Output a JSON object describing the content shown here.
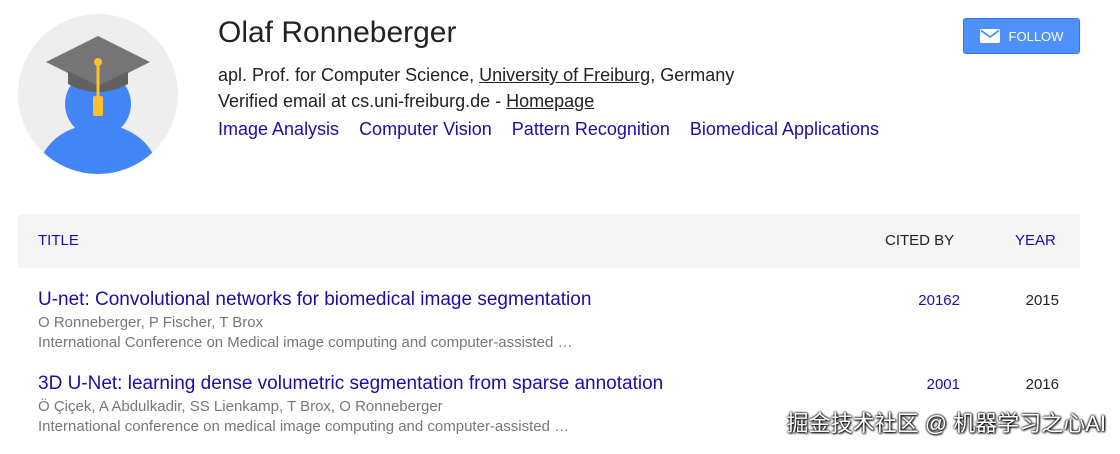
{
  "profile": {
    "name": "Olaf Ronneberger",
    "affiliation_prefix": "apl. Prof. for Computer Science, ",
    "affiliation_link": "University of Freiburg",
    "affiliation_suffix": ", Germany",
    "email_text": "Verified email at cs.uni-freiburg.de - ",
    "homepage_link": "Homepage",
    "interests": [
      "Image Analysis",
      "Computer Vision",
      "Pattern Recognition",
      "Biomedical Applications"
    ],
    "avatar_icon": "graduate-avatar-icon"
  },
  "follow_button": {
    "label": "FOLLOW",
    "icon": "mail-icon",
    "color": "#4d90fe"
  },
  "table": {
    "headers": {
      "title": "TITLE",
      "cited_by": "CITED BY",
      "year": "YEAR"
    },
    "rows": [
      {
        "title": "U-net: Convolutional networks for biomedical image segmentation",
        "authors": "O Ronneberger, P Fischer, T Brox",
        "venue": "International Conference on Medical image computing and computer-assisted …",
        "cited_by": "20162",
        "year": "2015"
      },
      {
        "title": "3D U-Net: learning dense volumetric segmentation from sparse annotation",
        "authors": "Ö Çiçek, A Abdulkadir, SS Lienkamp, T Brox, O Ronneberger",
        "venue": "International conference on medical image computing and computer-assisted …",
        "cited_by": "2001",
        "year": "2016"
      }
    ]
  },
  "watermark": "掘金技术社区 @ 机器学习之心AI",
  "colors": {
    "link": "#1a0dab",
    "header_bg": "#f5f5f5",
    "avatar_bg": "#eeeeee",
    "avatar_person": "#4285f4",
    "cap": "#757575",
    "tassel": "#fbc02d"
  }
}
